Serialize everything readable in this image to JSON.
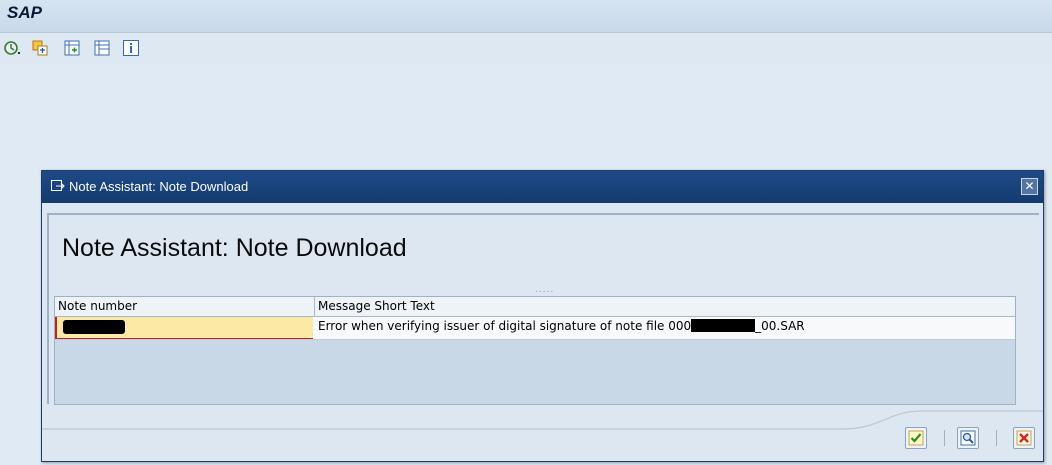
{
  "app": {
    "title": "SAP"
  },
  "toolbar": {
    "icons": [
      "execute-icon",
      "copy-icon",
      "add-table-icon",
      "table-icon",
      "info-icon"
    ]
  },
  "dialog": {
    "title": "Note Assistant: Note Download",
    "heading": "Note Assistant: Note Download",
    "table": {
      "columns": [
        "Note number",
        "Message Short Text"
      ],
      "rows": [
        {
          "note_number": "",
          "message_prefix": "Error when verifying issuer of digital signature of note file 000",
          "message_suffix": "_00.SAR"
        }
      ]
    },
    "footer_buttons": [
      "continue-button",
      "display-button",
      "cancel-button"
    ]
  },
  "colors": {
    "dialog_titlebar": "#1e4a86",
    "selected_cell": "#fde9a6",
    "background": "#dfeaf4"
  }
}
